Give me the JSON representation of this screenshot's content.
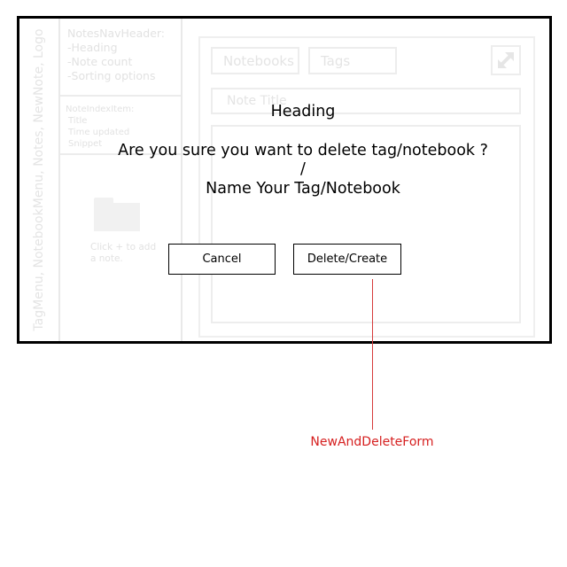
{
  "layout": {
    "sidebar_label": "TagMenu, NotebookMenu, Notes, NewNote, Logo",
    "notes_nav_header": {
      "title": "NotesNavHeader:",
      "items": [
        "-Heading",
        "-Note count",
        "-Sorting options"
      ]
    },
    "note_index_item": {
      "title": "NoteIndexItem:",
      "items": [
        "Title",
        "Time updated",
        "Snippet"
      ]
    },
    "empty_hint": "Click + to add a note."
  },
  "editor": {
    "tabs": [
      "Notebooks",
      "Tags"
    ],
    "title_placeholder": "Note Title",
    "expand_icon": "expand-icon"
  },
  "modal": {
    "heading": "Heading",
    "question": "Are you sure you want to delete tag/notebook ?",
    "separator": "/",
    "alternate": "Name Your Tag/Notebook",
    "cancel_label": "Cancel",
    "confirm_label": "Delete/Create"
  },
  "annotation": {
    "label": "NewAndDeleteForm",
    "color": "#d62020"
  }
}
